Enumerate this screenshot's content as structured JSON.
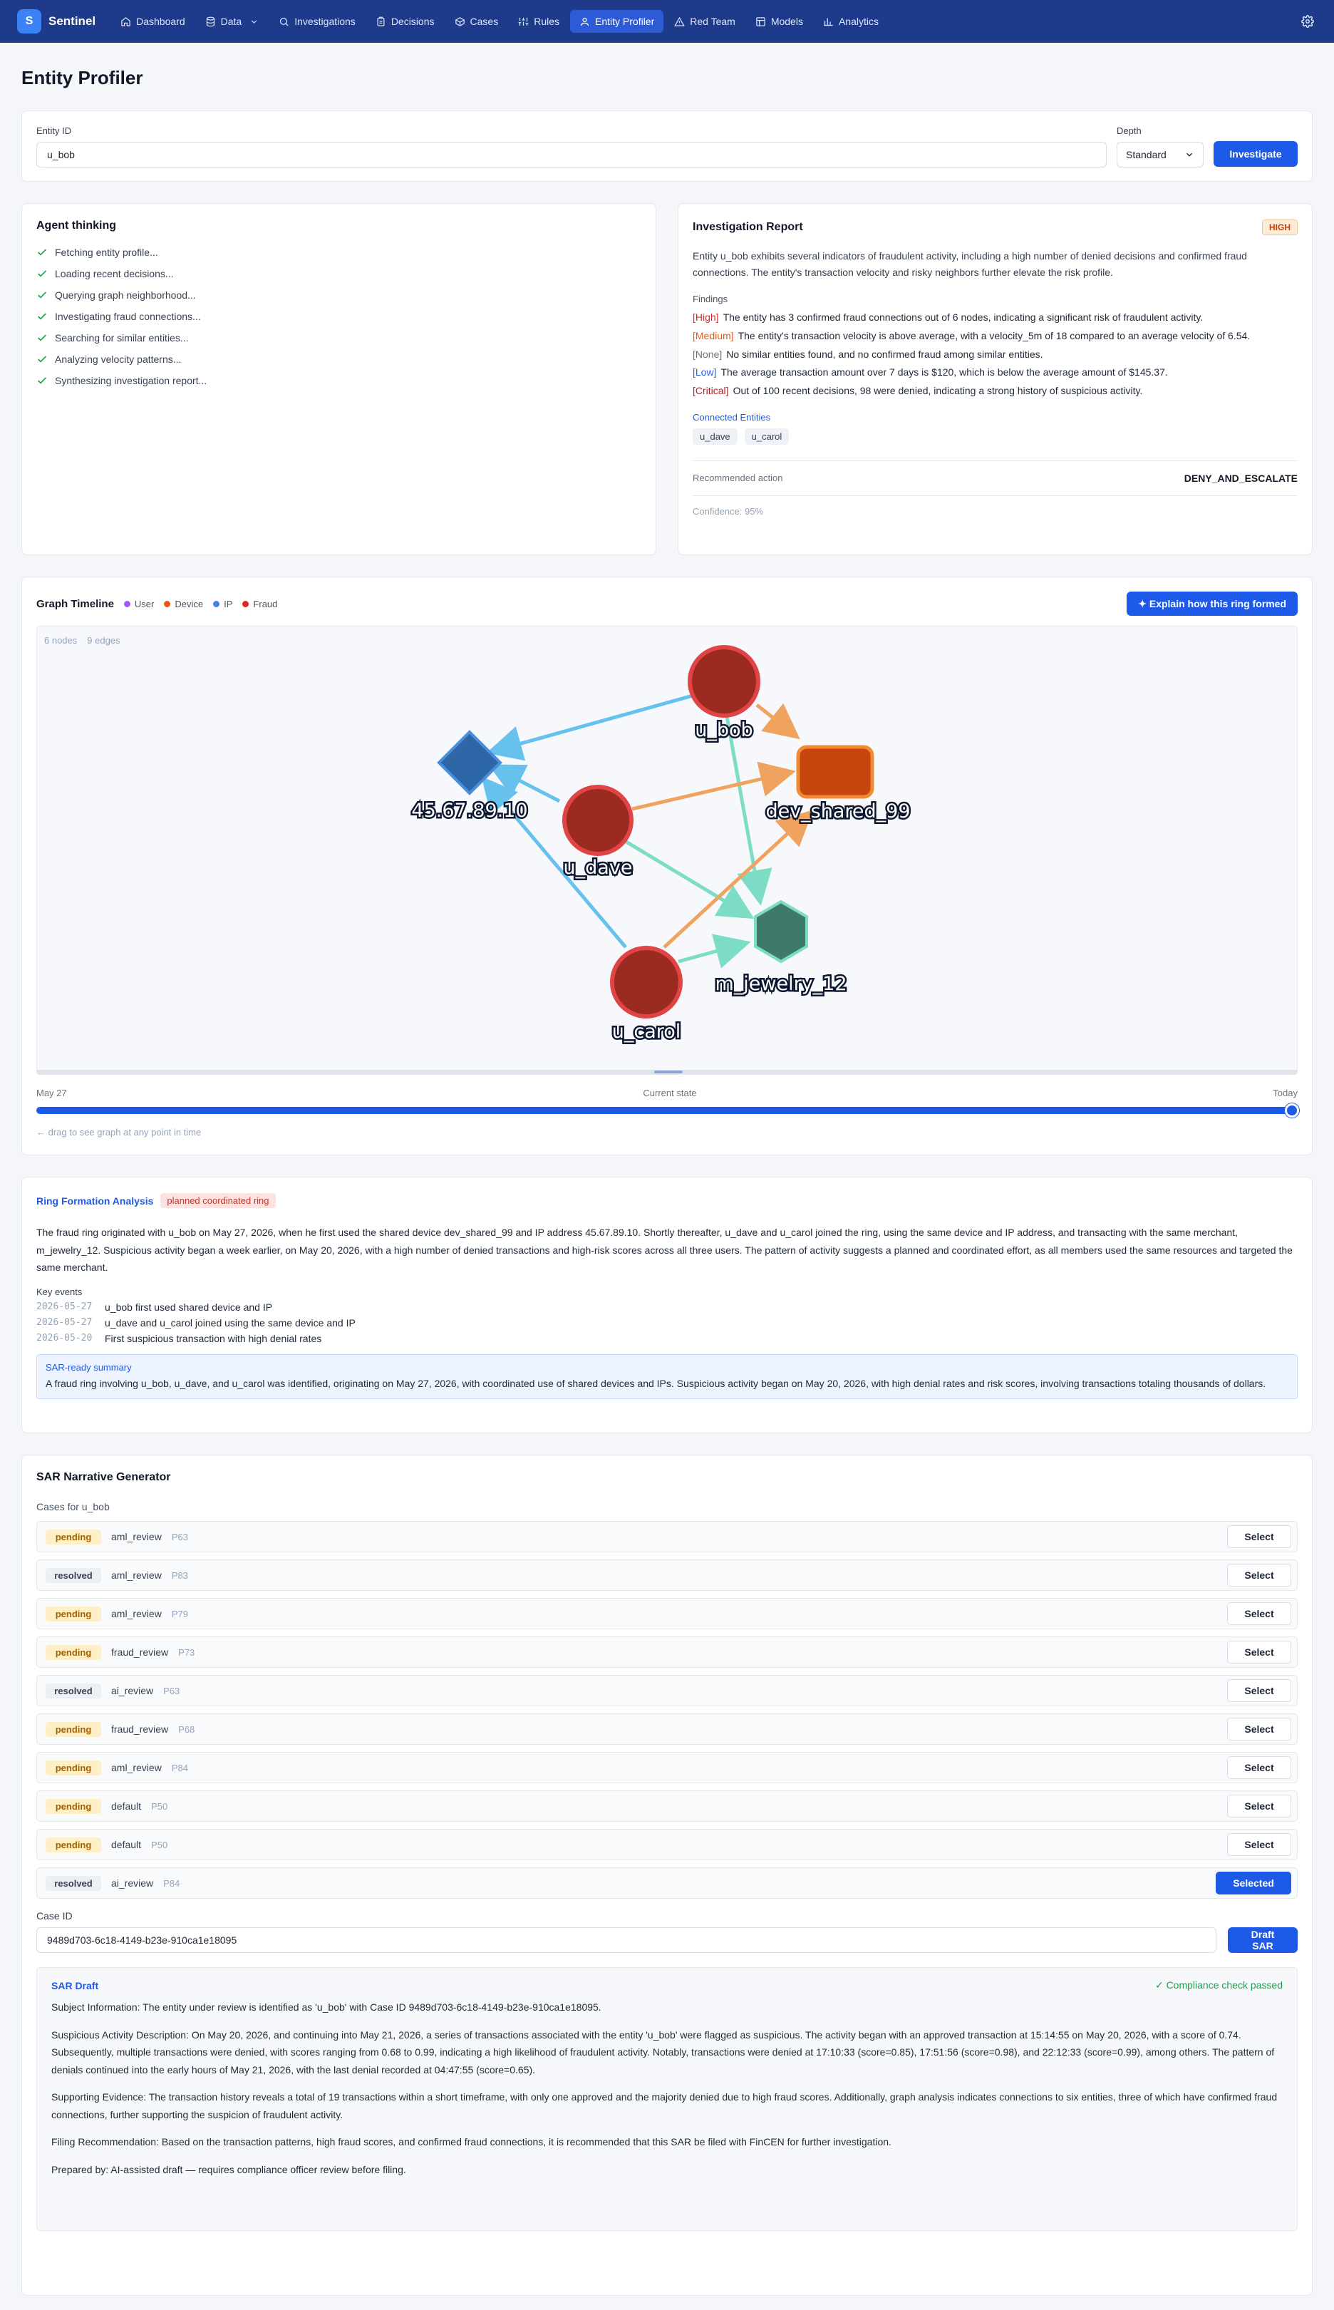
{
  "app": {
    "logo_letter": "S",
    "name": "Sentinel",
    "accent": "#1d5ae8",
    "nav_bg": "#1e3a8a"
  },
  "nav": [
    {
      "label": "Dashboard",
      "icon": "home-icon"
    },
    {
      "label": "Data",
      "icon": "database-icon",
      "dropdown": true
    },
    {
      "label": "Investigations",
      "icon": "search-icon"
    },
    {
      "label": "Decisions",
      "icon": "clipboard-icon"
    },
    {
      "label": "Cases",
      "icon": "box-icon"
    },
    {
      "label": "Rules",
      "icon": "sliders-icon"
    },
    {
      "label": "Entity Profiler",
      "icon": "user-icon",
      "active": true
    },
    {
      "label": "Red Team",
      "icon": "alert-triangle-icon"
    },
    {
      "label": "Models",
      "icon": "layout-icon"
    },
    {
      "label": "Analytics",
      "icon": "bar-chart-icon"
    }
  ],
  "page": {
    "title": "Entity Profiler"
  },
  "entity_form": {
    "entity_id_label": "Entity ID",
    "entity_id_value": "u_bob",
    "depth_label": "Depth",
    "depth_value": "Standard",
    "investigate_label": "Investigate"
  },
  "agent": {
    "title": "Agent thinking",
    "steps": [
      "Fetching entity profile...",
      "Loading recent decisions...",
      "Querying graph neighborhood...",
      "Investigating fraud connections...",
      "Searching for similar entities...",
      "Analyzing velocity patterns...",
      "Synthesizing investigation report..."
    ]
  },
  "report": {
    "title": "Investigation Report",
    "risk_badge": "HIGH",
    "summary": "Entity u_bob exhibits several indicators of fraudulent activity, including a high number of denied decisions and confirmed fraud connections. The entity's transaction velocity and risky neighbors further elevate the risk profile.",
    "findings_label": "Findings",
    "findings": [
      {
        "severity": "[High]",
        "class": "sev-high",
        "text": "The entity has 3 confirmed fraud connections out of 6 nodes, indicating a significant risk of fraudulent activity."
      },
      {
        "severity": "[Medium]",
        "class": "sev-medium",
        "text": "The entity's transaction velocity is above average, with a velocity_5m of 18 compared to an average velocity of 6.54."
      },
      {
        "severity": "[None]",
        "class": "sev-none",
        "text": "No similar entities found, and no confirmed fraud among similar entities."
      },
      {
        "severity": "[Low]",
        "class": "sev-low",
        "text": "The average transaction amount over 7 days is $120, which is below the average amount of $145.37."
      },
      {
        "severity": "[Critical]",
        "class": "sev-critical",
        "text": "Out of 100 recent decisions, 98 were denied, indicating a strong history of suspicious activity."
      }
    ],
    "connected_label": "Connected Entities",
    "connected": [
      "u_dave",
      "u_carol"
    ],
    "recommended_label": "Recommended action",
    "recommended_value": "DENY_AND_ESCALATE",
    "confidence": "Confidence: 95%"
  },
  "graph": {
    "title": "Graph Timeline",
    "legend": [
      {
        "label": "User",
        "color": "#a855f7"
      },
      {
        "label": "Device",
        "color": "#ea580c"
      },
      {
        "label": "IP",
        "color": "#3b82f6"
      },
      {
        "label": "Fraud",
        "color": "#dc2626"
      }
    ],
    "explain_label": "✦ Explain how this ring formed",
    "nodes_count": "6 nodes",
    "edges_count": "9 edges",
    "nodes": [
      {
        "id": "u_bob",
        "label": "u_bob",
        "shape": "circle"
      },
      {
        "id": "ip",
        "label": "45.67.89.10",
        "shape": "diamond"
      },
      {
        "id": "dev",
        "label": "dev_shared_99",
        "shape": "rect"
      },
      {
        "id": "u_dave",
        "label": "u_dave",
        "shape": "circle"
      },
      {
        "id": "m_jewelry",
        "label": "m_jewelry_12",
        "shape": "hexagon"
      },
      {
        "id": "u_carol",
        "label": "u_carol",
        "shape": "circle"
      }
    ],
    "timeline_start": "May 27",
    "timeline_mid": "Current state",
    "timeline_end": "Today",
    "drag_hint": "← drag to see graph at any point in time"
  },
  "ring": {
    "title": "Ring Formation Analysis",
    "badge": "planned coordinated ring",
    "text": "The fraud ring originated with u_bob on May 27, 2026, when he first used the shared device dev_shared_99 and IP address 45.67.89.10. Shortly thereafter, u_dave and u_carol joined the ring, using the same device and IP address, and transacting with the same merchant, m_jewelry_12. Suspicious activity began a week earlier, on May 20, 2026, with a high number of denied transactions and high-risk scores across all three users. The pattern of activity suggests a planned and coordinated effort, as all members used the same resources and targeted the same merchant.",
    "key_events_label": "Key events",
    "events": [
      {
        "date": "2026-05-27",
        "text": "u_bob first used shared device and IP"
      },
      {
        "date": "2026-05-27",
        "text": "u_dave and u_carol joined using the same device and IP"
      },
      {
        "date": "2026-05-20",
        "text": "First suspicious transaction with high denial rates"
      }
    ],
    "sar_summary_title": "SAR-ready summary",
    "sar_summary_text": "A fraud ring involving u_bob, u_dave, and u_carol was identified, originating on May 27, 2026, with coordinated use of shared devices and IPs. Suspicious activity began on May 20, 2026, with high denial rates and risk scores, involving transactions totaling thousands of dollars."
  },
  "sar": {
    "title": "SAR Narrative Generator",
    "cases_label": "Cases for u_bob",
    "cases": [
      {
        "status": "pending",
        "type": "aml_review",
        "priority": "P63",
        "action": "Select"
      },
      {
        "status": "resolved",
        "type": "aml_review",
        "priority": "P83",
        "action": "Select"
      },
      {
        "status": "pending",
        "type": "aml_review",
        "priority": "P79",
        "action": "Select"
      },
      {
        "status": "pending",
        "type": "fraud_review",
        "priority": "P73",
        "action": "Select"
      },
      {
        "status": "resolved",
        "type": "ai_review",
        "priority": "P63",
        "action": "Select"
      },
      {
        "status": "pending",
        "type": "fraud_review",
        "priority": "P68",
        "action": "Select"
      },
      {
        "status": "pending",
        "type": "aml_review",
        "priority": "P84",
        "action": "Select"
      },
      {
        "status": "pending",
        "type": "default",
        "priority": "P50",
        "action": "Select"
      },
      {
        "status": "pending",
        "type": "default",
        "priority": "P50",
        "action": "Select"
      },
      {
        "status": "resolved",
        "type": "ai_review",
        "priority": "P84",
        "action": "Selected",
        "selected": true
      }
    ],
    "case_id_label": "Case ID",
    "case_id_value": "9489d703-6c18-4149-b23e-910ca1e18095",
    "draft_label": "Draft SAR",
    "draft_title": "SAR Draft",
    "compliance": "✓ Compliance check passed",
    "paragraphs": [
      "Subject Information: The entity under review is identified as 'u_bob' with Case ID 9489d703-6c18-4149-b23e-910ca1e18095.",
      "Suspicious Activity Description: On May 20, 2026, and continuing into May 21, 2026, a series of transactions associated with the entity 'u_bob' were flagged as suspicious. The activity began with an approved transaction at 15:14:55 on May 20, 2026, with a score of 0.74. Subsequently, multiple transactions were denied, with scores ranging from 0.68 to 0.99, indicating a high likelihood of fraudulent activity. Notably, transactions were denied at 17:10:33 (score=0.85), 17:51:56 (score=0.98), and 22:12:33 (score=0.99), among others. The pattern of denials continued into the early hours of May 21, 2026, with the last denial recorded at 04:47:55 (score=0.65).",
      "Supporting Evidence: The transaction history reveals a total of 19 transactions within a short timeframe, with only one approved and the majority denied due to high fraud scores. Additionally, graph analysis indicates connections to six entities, three of which have confirmed fraud connections, further supporting the suspicion of fraudulent activity.",
      "Filing Recommendation: Based on the transaction patterns, high fraud scores, and confirmed fraud connections, it is recommended that this SAR be filed with FinCEN for further investigation.",
      "Prepared by: AI-assisted draft — requires compliance officer review before filing."
    ]
  }
}
